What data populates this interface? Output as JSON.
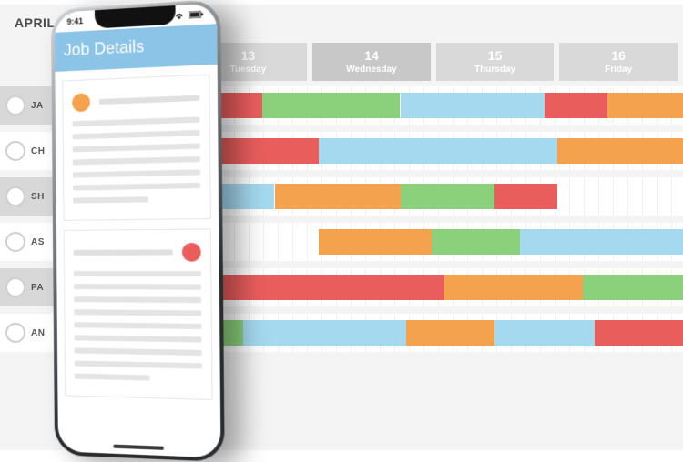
{
  "gantt": {
    "title": "APRIL 2",
    "columns": [
      {
        "date": "",
        "dow": "",
        "muted": true
      },
      {
        "date": "13",
        "dow": "Tuesday",
        "muted": false
      },
      {
        "date": "14",
        "dow": "Wednesday",
        "muted": true
      },
      {
        "date": "15",
        "dow": "Thursday",
        "muted": false
      },
      {
        "date": "16",
        "dow": "Friday",
        "muted": false
      }
    ],
    "colors": {
      "red": "#ea5d5d",
      "green": "#8bd17c",
      "blue": "#a4d9ef",
      "orange": "#f4a24e"
    },
    "rows": [
      {
        "name": "JA",
        "shaded": true,
        "segments": [
          {
            "start": 0.14,
            "end": 0.33,
            "color": "red"
          },
          {
            "start": 0.33,
            "end": 0.55,
            "color": "green"
          },
          {
            "start": 0.55,
            "end": 0.78,
            "color": "blue"
          },
          {
            "start": 0.78,
            "end": 0.88,
            "color": "red"
          },
          {
            "start": 0.88,
            "end": 1.0,
            "color": "orange"
          }
        ]
      },
      {
        "name": "CH",
        "shaded": false,
        "segments": [
          {
            "start": 0.14,
            "end": 0.42,
            "color": "red"
          },
          {
            "start": 0.42,
            "end": 0.8,
            "color": "blue"
          },
          {
            "start": 0.8,
            "end": 1.0,
            "color": "orange"
          }
        ]
      },
      {
        "name": "SH",
        "shaded": true,
        "segments": [
          {
            "start": 0.14,
            "end": 0.35,
            "color": "blue"
          },
          {
            "start": 0.35,
            "end": 0.55,
            "color": "orange"
          },
          {
            "start": 0.55,
            "end": 0.7,
            "color": "green"
          },
          {
            "start": 0.7,
            "end": 0.8,
            "color": "red"
          }
        ]
      },
      {
        "name": "AS",
        "shaded": false,
        "segments": [
          {
            "start": 0.42,
            "end": 0.6,
            "color": "orange"
          },
          {
            "start": 0.6,
            "end": 0.74,
            "color": "green"
          },
          {
            "start": 0.74,
            "end": 1.0,
            "color": "blue"
          }
        ]
      },
      {
        "name": "PA",
        "shaded": true,
        "segments": [
          {
            "start": 0.14,
            "end": 0.62,
            "color": "red"
          },
          {
            "start": 0.62,
            "end": 0.84,
            "color": "orange"
          },
          {
            "start": 0.84,
            "end": 1.0,
            "color": "green"
          }
        ]
      },
      {
        "name": "AN",
        "shaded": false,
        "segments": [
          {
            "start": 0.14,
            "end": 0.3,
            "color": "green"
          },
          {
            "start": 0.3,
            "end": 0.56,
            "color": "blue"
          },
          {
            "start": 0.56,
            "end": 0.7,
            "color": "orange"
          },
          {
            "start": 0.7,
            "end": 0.86,
            "color": "blue"
          },
          {
            "start": 0.86,
            "end": 1.0,
            "color": "red"
          }
        ]
      }
    ]
  },
  "phone": {
    "clock": "9:41",
    "app_title": "Job Details",
    "cards": [
      {
        "dot_color": "#f4a24e",
        "lines": 7
      },
      {
        "dot_color": "#ea5d5d",
        "lines": 9,
        "dot_right": true
      }
    ]
  }
}
